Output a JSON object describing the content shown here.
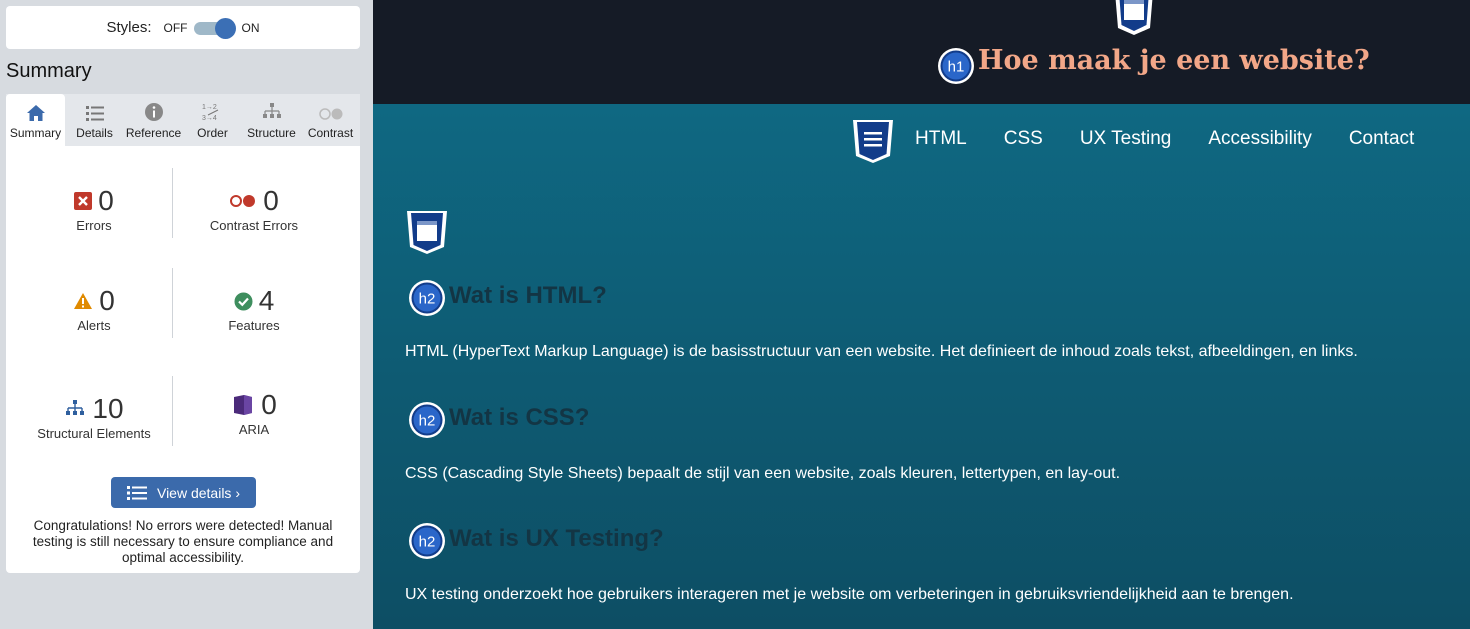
{
  "wave": {
    "styles_label": "Styles:",
    "off_label": "OFF",
    "on_label": "ON",
    "summary_heading": "Summary",
    "tabs": [
      {
        "label": "Summary",
        "icon": "home-icon"
      },
      {
        "label": "Details",
        "icon": "list-icon"
      },
      {
        "label": "Reference",
        "icon": "info-icon"
      },
      {
        "label": "Order",
        "icon": "order-icon"
      },
      {
        "label": "Structure",
        "icon": "structure-icon"
      },
      {
        "label": "Contrast",
        "icon": "contrast-toggle-icon"
      }
    ],
    "stats": {
      "errors": {
        "count": "0",
        "label": "Errors"
      },
      "contrast": {
        "count": "0",
        "label": "Contrast Errors"
      },
      "alerts": {
        "count": "0",
        "label": "Alerts"
      },
      "features": {
        "count": "4",
        "label": "Features"
      },
      "structural": {
        "count": "10",
        "label": "Structural Elements"
      },
      "aria": {
        "count": "0",
        "label": "ARIA"
      }
    },
    "view_details": "View details ›",
    "congrats": "Congratulations! No errors were detected! Manual testing is still necessary to ensure compliance and optimal accessibility."
  },
  "site": {
    "h1_badge": "h1",
    "h1": "Hoe maak je een website?",
    "nav": [
      "HTML",
      "CSS",
      "UX Testing",
      "Accessibility",
      "Contact"
    ],
    "sections": [
      {
        "badge": "h2",
        "heading": "Wat is HTML?",
        "text": "HTML (HyperText Markup Language) is de basisstructuur van een website. Het definieert de inhoud zoals tekst, afbeeldingen, en links."
      },
      {
        "badge": "h2",
        "heading": "Wat is CSS?",
        "text": "CSS (Cascading Style Sheets) bepaalt de stijl van een website, zoals kleuren, lettertypen, en lay-out."
      },
      {
        "badge": "h2",
        "heading": "Wat is UX Testing?",
        "text": "UX testing onderzoekt hoe gebruikers interageren met je website om verbeteringen in gebruiksvriendelijkheid aan te brengen."
      }
    ]
  },
  "colors": {
    "wave_blue": "#3b6aab",
    "error_red": "#c0392b",
    "feature_green": "#3e8e5e",
    "alert_orange": "#e08a00",
    "aria_purple": "#4b2a7a",
    "hero_bg": "#151b26",
    "page_teal": "#0f6882",
    "h1_color": "#f2a788"
  }
}
